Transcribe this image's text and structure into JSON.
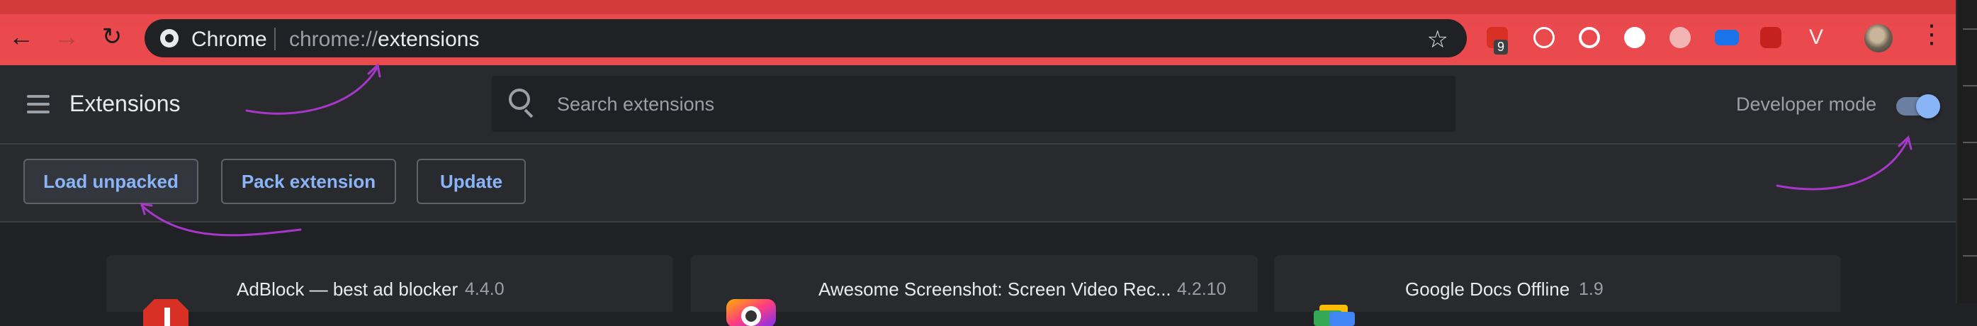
{
  "browser": {
    "site_chip": "Chrome",
    "url_scheme": "chrome://",
    "url_path": "extensions",
    "extension_badge_count": "9",
    "colors": {
      "toolbar": "#ea4b4f",
      "omnibox": "#202124"
    }
  },
  "header": {
    "title": "Extensions",
    "search_placeholder": "Search extensions",
    "developer_mode_label": "Developer mode",
    "developer_mode_on": true
  },
  "actions": {
    "load_unpacked": "Load unpacked",
    "pack_extension": "Pack extension",
    "update": "Update"
  },
  "extensions": [
    {
      "name": "AdBlock — best ad blocker",
      "version": "4.4.0",
      "icon": "adblock-icon"
    },
    {
      "name": "Awesome Screenshot: Screen Video Rec...",
      "version": "4.2.10",
      "icon": "awesome-screenshot-icon"
    },
    {
      "name": "Google Docs Offline",
      "version": "1.9",
      "icon": "google-docs-offline-icon"
    }
  ],
  "theme": {
    "accent": "#8ab4f8",
    "annotation": "#a637c9"
  }
}
